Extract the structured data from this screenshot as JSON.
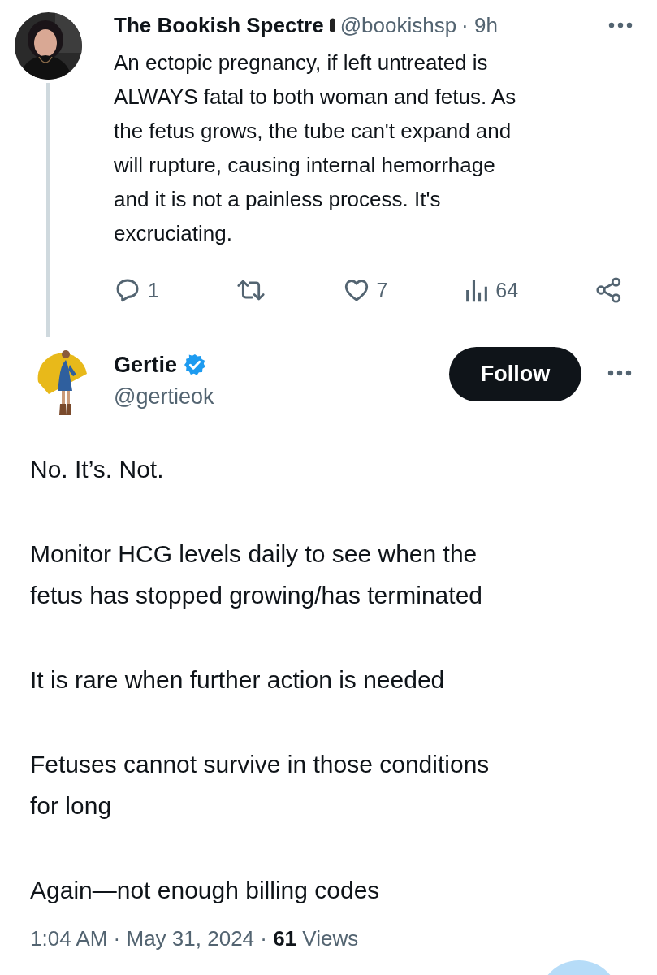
{
  "parent_post": {
    "author": {
      "name": "The Bookish Spectre",
      "handle": "@bookishsp",
      "time": "· 9h"
    },
    "text_lines": [
      "An ectopic pregnancy,  if left untreated is",
      "ALWAYS fatal to both woman and fetus. As",
      "the fetus grows, the tube can't expand and",
      "will rupture, causing internal hemorrhage",
      "and it is not a painless process. It's",
      "excruciating."
    ],
    "actions": [
      {
        "kind": "reply",
        "count": "1"
      },
      {
        "kind": "repost"
      },
      {
        "kind": "like",
        "count": "7"
      },
      {
        "kind": "views",
        "count": "64"
      },
      {
        "kind": "share"
      }
    ]
  },
  "post": {
    "author": {
      "name": "Gertie",
      "handle": "@gertieok",
      "verified": true
    },
    "follow_button": "Follow",
    "paragraphs": [
      [
        "No. It’s. Not."
      ],
      [
        "Monitor HCG levels daily to see when the",
        "fetus has stopped growing/has terminated"
      ],
      [
        "It is rare when further action is needed"
      ],
      [
        "Fetuses cannot survive in those conditions",
        "for long"
      ],
      [
        "Again—not enough billing codes"
      ]
    ],
    "meta": "1:04 AM · May 31, 2024 · **61** Views"
  }
}
